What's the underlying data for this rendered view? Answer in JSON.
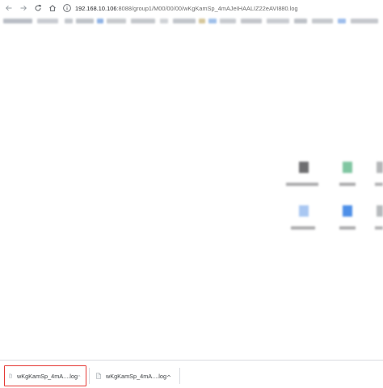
{
  "toolbar": {
    "url_host": "192.168.10.106",
    "url_rest": ":8088/group1/M00/00/00/wKgKamSp_4mAJeIHAALIZ22eAVI880.log",
    "icons": [
      "back-arrow-icon",
      "forward-arrow-icon",
      "reload-icon",
      "home-icon",
      "info-icon"
    ]
  },
  "download_shelf": {
    "items": [
      {
        "filename": "wKgKamSp_4mA....log",
        "highlighted": true,
        "icon": "file-icon",
        "menu_icon": "chevron-up-icon"
      },
      {
        "filename": "wKgKamSp_4mA....log",
        "highlighted": false,
        "icon": "file-icon",
        "menu_icon": "chevron-up-icon"
      }
    ]
  },
  "colors": {
    "highlight_border": "#e53935",
    "shelf_border": "#dadce0",
    "text": "#3c4043"
  }
}
